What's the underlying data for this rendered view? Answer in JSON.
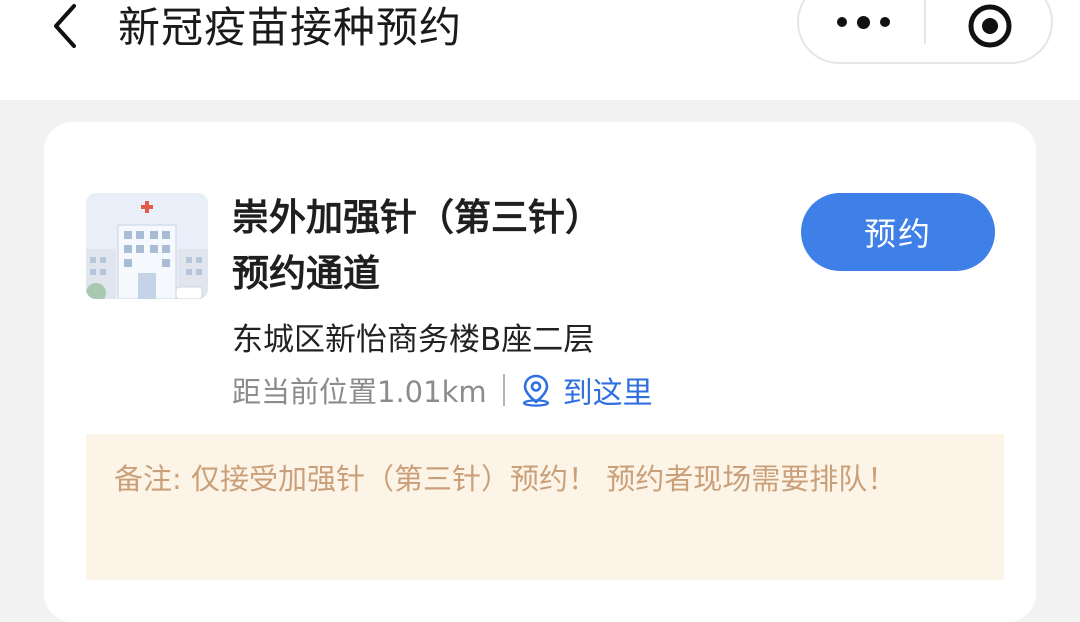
{
  "header": {
    "title": "新冠疫苗接种预约",
    "back_icon": "chevron-left-icon",
    "more_icon": "more-dots-icon",
    "close_icon": "target-close-icon"
  },
  "site": {
    "name": "崇外加强针（第三针）\n预约通道",
    "book_label": "预约",
    "address": "东城区新怡商务楼B座二层",
    "distance": "距当前位置1.01km",
    "navigate_label": "到这里",
    "navigate_icon": "location-pin-icon",
    "thumbnail_icon": "hospital-icon"
  },
  "note": {
    "text": "备注: 仅接受加强针（第三针）预约！ 预约者现场需要排队！"
  },
  "colors": {
    "accent": "#3f7fe8",
    "link": "#2f6fe0",
    "note_bg": "#fcf4e6",
    "note_text": "#caa07a"
  }
}
